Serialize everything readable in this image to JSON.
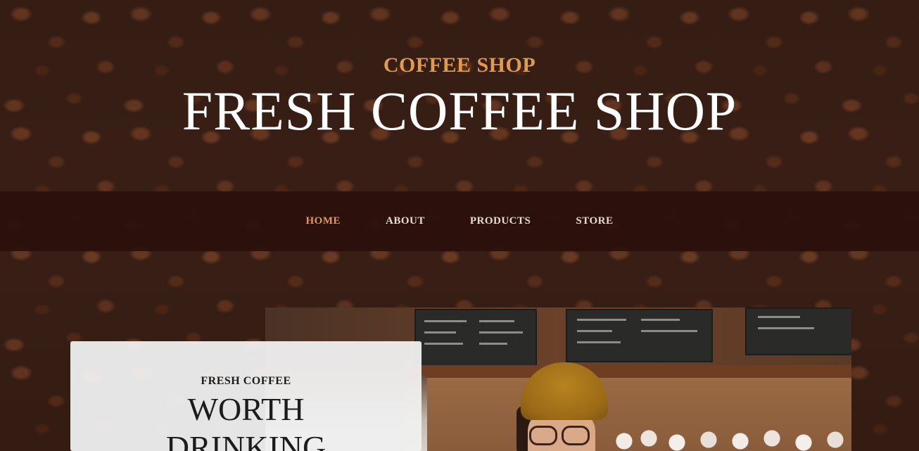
{
  "header": {
    "eyebrow": "COFFEE SHOP",
    "title": "FRESH COFFEE SHOP"
  },
  "nav": {
    "items": [
      {
        "label": "HOME",
        "active": true
      },
      {
        "label": "ABOUT",
        "active": false
      },
      {
        "label": "PRODUCTS",
        "active": false
      },
      {
        "label": "STORE",
        "active": false
      }
    ]
  },
  "intro": {
    "eyebrow": "FRESH COFFEE",
    "title_line1": "WORTH",
    "title_line2": "DRINKING"
  },
  "colors": {
    "accent": "#e09a52",
    "nav_background": "#2b100c",
    "card_background": "#f0f0f0"
  }
}
